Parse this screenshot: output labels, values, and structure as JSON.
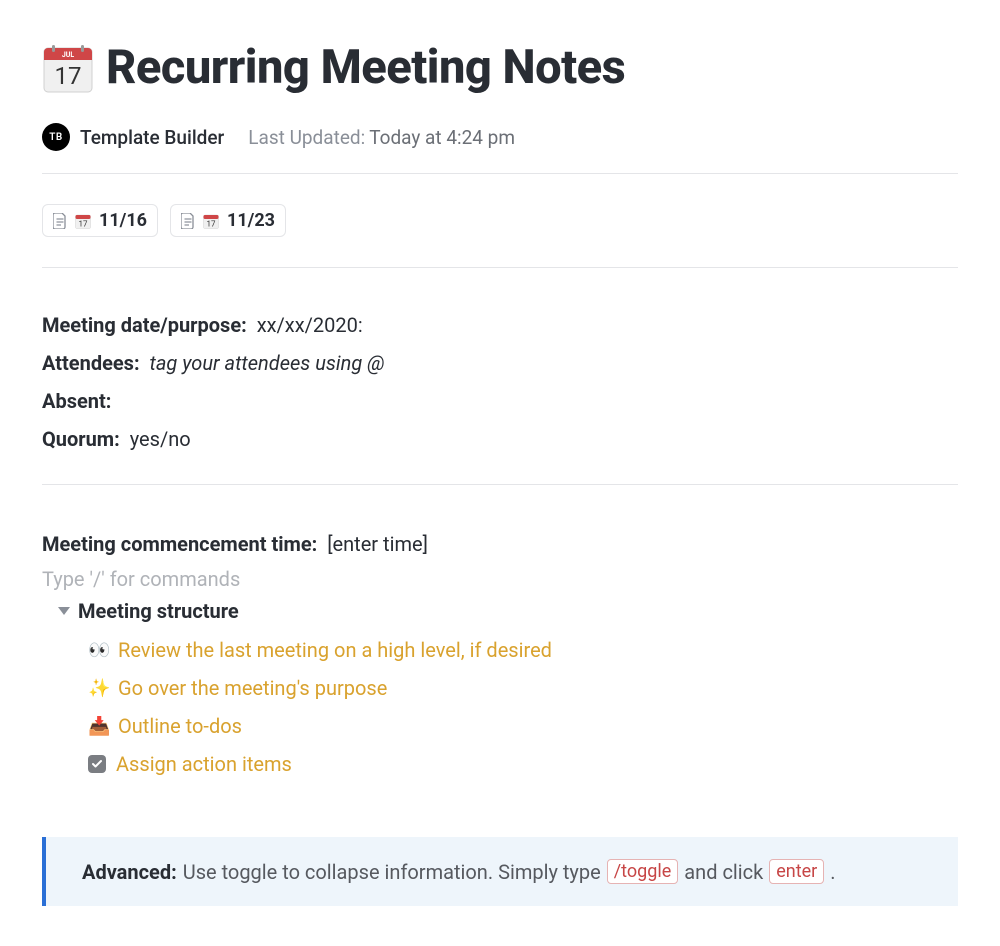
{
  "page": {
    "title": "Recurring Meeting Notes",
    "icon": "calendar-icon"
  },
  "meta": {
    "author_initials": "TB",
    "author_name": "Template Builder",
    "updated_label": "Last Updated:",
    "updated_value": "Today at 4:24 pm"
  },
  "chips": [
    {
      "label": "11/16"
    },
    {
      "label": "11/23"
    }
  ],
  "fields": {
    "meeting_date_label": "Meeting date/purpose:",
    "meeting_date_value": "xx/xx/2020:",
    "attendees_label": "Attendees:",
    "attendees_value": "tag your attendees using @",
    "absent_label": "Absent:",
    "absent_value": "",
    "quorum_label": "Quorum:",
    "quorum_value": "yes/no"
  },
  "commence": {
    "label": "Meeting commencement time:",
    "value": "[enter time]",
    "placeholder": "Type '/' for commands"
  },
  "toggle": {
    "label": "Meeting structure",
    "items": [
      {
        "icon": "👀",
        "text": "Review the last meeting on a high level, if desired"
      },
      {
        "icon": "✨",
        "text": "Go over the meeting's purpose"
      },
      {
        "icon": "📥",
        "text": "Outline to-dos"
      },
      {
        "icon": "check",
        "text": "Assign action items"
      }
    ]
  },
  "advanced": {
    "label": "Advanced:",
    "text1": "Use toggle to collapse information. Simply type",
    "kbd1": "/toggle",
    "text2": "and click",
    "kbd2": "enter",
    "text3": "."
  }
}
